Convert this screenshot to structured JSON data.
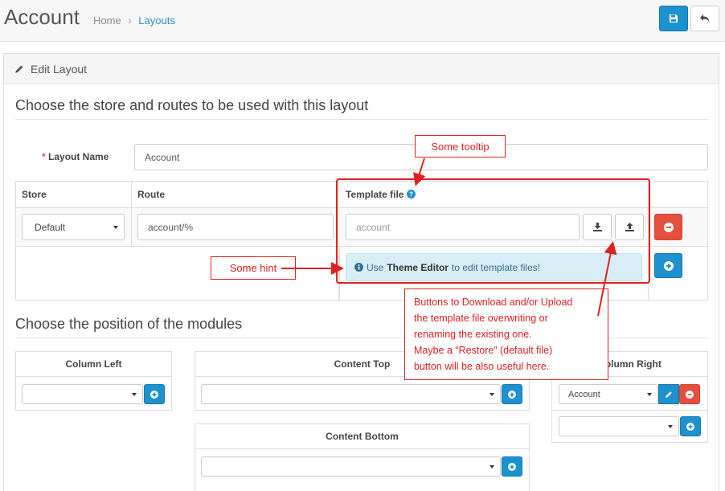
{
  "header": {
    "title": "Account",
    "breadcrumb": {
      "home": "Home",
      "sep": "›",
      "current": "Layouts"
    }
  },
  "panel": {
    "heading": "Edit Layout",
    "legend_routes": "Choose the store and routes to be used with this layout",
    "legend_modules": "Choose the position of the modules"
  },
  "form": {
    "layout_name_label": "Layout Name",
    "required_mark": "*",
    "layout_name_value": "Account"
  },
  "routes_table": {
    "headers": {
      "store": "Store",
      "route": "Route",
      "template": "Template file"
    },
    "row": {
      "store": "Default",
      "route": "account/%",
      "template_placeholder": "account"
    },
    "info_prefix": "Use",
    "info_bold": "Theme Editor",
    "info_suffix": "to edit template files!"
  },
  "modules": {
    "column_left": "Column Left",
    "content_top": "Content Top",
    "content_bottom": "Content Bottom",
    "column_right": "Column Right",
    "column_right_selected": "Account"
  },
  "annotations": {
    "tooltip": "Some tooltip",
    "hint": "Some hint",
    "buttons_note": "Buttons to Download and/or Upload\nthe template file overwriting or\nrenaming the existing one.\nMaybe a “Restore” (default file)\nbutton will be also useful here."
  },
  "colors": {
    "primary": "#1e91cf",
    "danger": "#e3503e",
    "annotation": "#e02020",
    "info_bg": "#d9edf7"
  },
  "icons": {
    "save": "save-icon",
    "back": "reply-icon",
    "edit": "pencil-icon",
    "help": "question-circle-icon",
    "download": "download-icon",
    "upload": "upload-icon",
    "remove": "minus-circle-icon",
    "add": "plus-circle-icon",
    "info": "info-circle-icon"
  }
}
